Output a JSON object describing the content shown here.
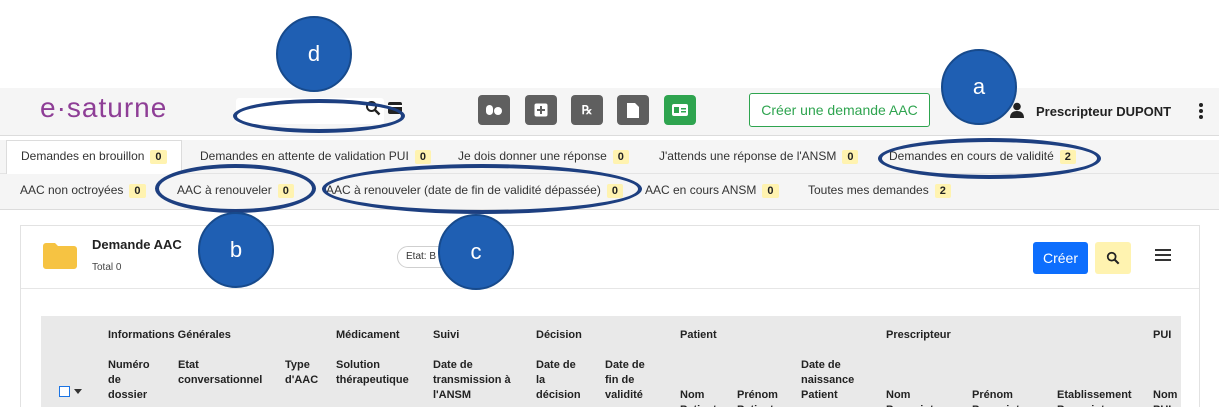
{
  "header": {
    "logo_text": "e·saturne",
    "create_request_label": "Créer une demande AAC",
    "user_name": "Prescripteur DUPONT",
    "toolbar_icons": [
      "pills-icon",
      "plus-square-icon",
      "rx-icon",
      "file-icon",
      "id-card-icon"
    ]
  },
  "tabs_row1": [
    {
      "label": "Demandes en brouillon",
      "count": "0"
    },
    {
      "label": "Demandes en attente de validation PUI",
      "count": "0"
    },
    {
      "label": "Je dois donner une réponse",
      "count": "0"
    },
    {
      "label": "J'attends une réponse de l'ANSM",
      "count": "0"
    },
    {
      "label": "Demandes en cours de validité",
      "count": "2"
    }
  ],
  "tabs_row2": [
    {
      "label": "AAC non octroyées",
      "count": "0"
    },
    {
      "label": "AAC à renouveler",
      "count": "0"
    },
    {
      "label": "AAC à renouveler (date de fin de validité dépassée)",
      "count": "0"
    },
    {
      "label": "AAC en cours ANSM",
      "count": "0"
    },
    {
      "label": "Toutes mes demandes",
      "count": "2"
    }
  ],
  "panel": {
    "title": "Demande AAC",
    "total": "Total 0",
    "state_chip": "Etat: B",
    "create_label": "Créer"
  },
  "table": {
    "groups": [
      "Informations Générales",
      "Médicament",
      "Suivi",
      "Décision",
      "Patient",
      "Prescripteur",
      "PUI"
    ],
    "columns": [
      "Numéro de dossier",
      "Etat conversationnel",
      "Type d'AAC",
      "Solution thérapeutique",
      "Date de transmission à l'ANSM",
      "Date de la décision",
      "Date de fin de validité",
      "Nom Patient",
      "Prénom Patient",
      "Date de naissance Patient",
      "Nom Prescripteur",
      "Prénom Prescripteur",
      "Etablissement Prescripteur",
      "Nom PUI"
    ]
  },
  "annotations": [
    "d",
    "a",
    "b",
    "c"
  ],
  "colors": {
    "accent_green": "#2ea44f",
    "primary_blue": "#0d6efd",
    "badge_yellow": "#fff3b0",
    "annotation_blue": "#1f5fb3",
    "logo_purple": "#8e3e96"
  }
}
